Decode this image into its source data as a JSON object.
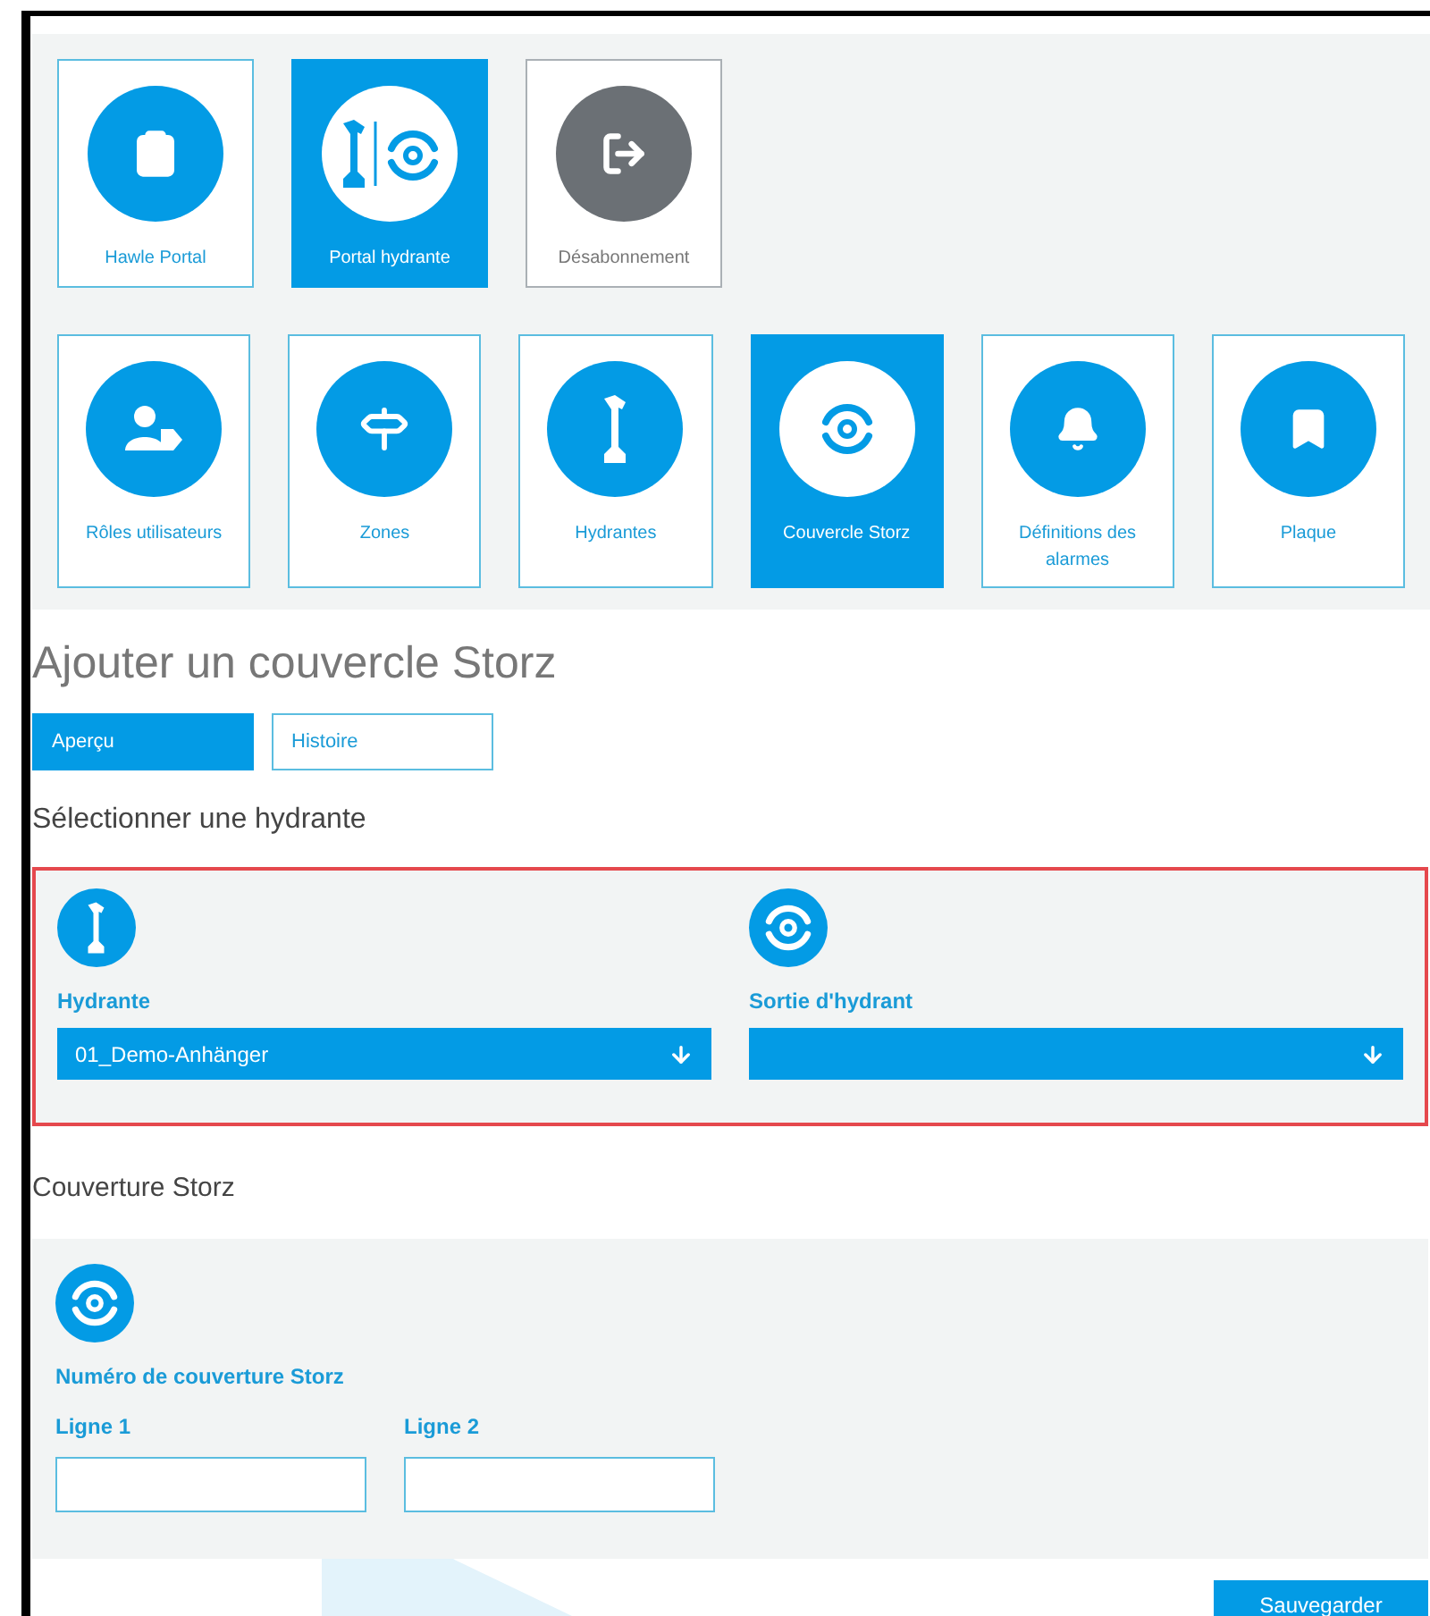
{
  "top_tiles": [
    {
      "label": "Hawle Portal",
      "kind": "clipboard",
      "selected": false,
      "muted": false
    },
    {
      "label": "Portal hydrante",
      "kind": "hydrant-storz",
      "selected": true,
      "muted": false
    },
    {
      "label": "Désabonnement",
      "kind": "logout",
      "selected": false,
      "muted": true
    }
  ],
  "module_tiles": [
    {
      "label": "Rôles utilisateurs",
      "kind": "user-tag",
      "selected": false
    },
    {
      "label": "Zones",
      "kind": "signpost",
      "selected": false
    },
    {
      "label": "Hydrantes",
      "kind": "hydrant",
      "selected": false
    },
    {
      "label": "Couvercle Storz",
      "kind": "storz",
      "selected": true
    },
    {
      "label": "Définitions des alarmes",
      "kind": "bell",
      "selected": false
    },
    {
      "label": "Plaque",
      "kind": "bookmark",
      "selected": false
    }
  ],
  "page_title": "Ajouter un couvercle Storz",
  "tabs": [
    {
      "label": "Aperçu",
      "selected": true
    },
    {
      "label": "Histoire",
      "selected": false
    }
  ],
  "select_section": {
    "title": "Sélectionner une hydrante",
    "highlighted": true,
    "fields": [
      {
        "kind": "hydrant",
        "label": "Hydrante",
        "value": "01_Demo-Anhänger"
      },
      {
        "kind": "storz",
        "label": "Sortie d'hydrant"
      }
    ]
  },
  "cover_section": {
    "title": "Couverture Storz",
    "subtitle": "Numéro de couverture Storz",
    "fields": [
      {
        "label": "Ligne 1"
      },
      {
        "label": "Ligne 2"
      }
    ]
  },
  "save_button": "Sauvegarder"
}
